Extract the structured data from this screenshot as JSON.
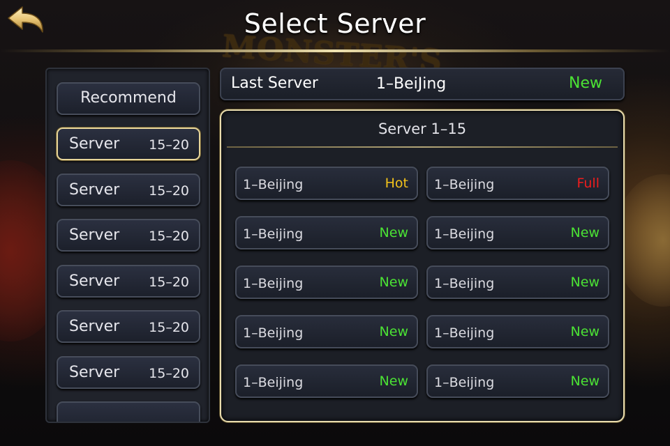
{
  "header": {
    "title": "Select Server",
    "back_icon": "curved-arrow-back-icon"
  },
  "background": {
    "watermark_text": "MONSTER'S"
  },
  "sidebar": {
    "recommend_label": "Recommend",
    "selected_index": 0,
    "groups": [
      {
        "label": "Server",
        "range": "15–20"
      },
      {
        "label": "Server",
        "range": "15–20"
      },
      {
        "label": "Server",
        "range": "15–20"
      },
      {
        "label": "Server",
        "range": "15–20"
      },
      {
        "label": "Server",
        "range": "15–20"
      },
      {
        "label": "Server",
        "range": "15–20"
      }
    ]
  },
  "last_server": {
    "label": "Last Server",
    "server": "1–BeiJing",
    "status": "New"
  },
  "panel": {
    "title": "Server 1–15",
    "servers": [
      {
        "name": "1–Beijing",
        "status": "Hot"
      },
      {
        "name": "1–Beijing",
        "status": "Full"
      },
      {
        "name": "1–Beijing",
        "status": "New"
      },
      {
        "name": "1–Beijing",
        "status": "New"
      },
      {
        "name": "1–Beijing",
        "status": "New"
      },
      {
        "name": "1–Beijing",
        "status": "New"
      },
      {
        "name": "1–Beijing",
        "status": "New"
      },
      {
        "name": "1–Beijing",
        "status": "New"
      },
      {
        "name": "1–Beijing",
        "status": "New"
      },
      {
        "name": "1–Beijing",
        "status": "New"
      }
    ]
  },
  "colors": {
    "gold_border": "#e9dcae",
    "status_new": "#4be334",
    "status_hot": "#f2c21a",
    "status_full": "#ee1d1d"
  }
}
